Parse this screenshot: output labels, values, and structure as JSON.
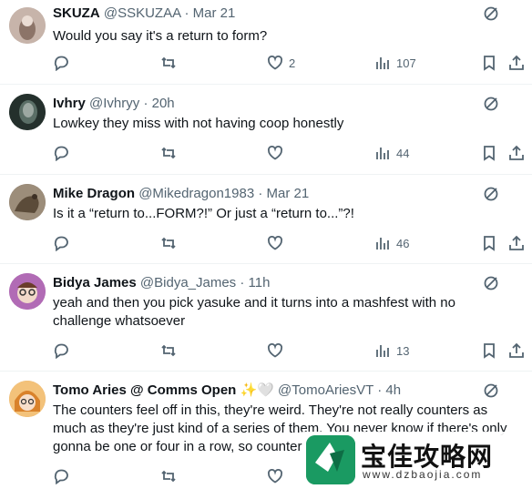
{
  "tweets": [
    {
      "name": "SKUZA",
      "handle": "@SSKUZAA",
      "dot": "·",
      "time": "Mar 21",
      "text": "Would you say it's a return to form?",
      "replies": "",
      "retweets": "",
      "likes": "2",
      "views": "107",
      "avatar_color": "#b9a59a"
    },
    {
      "name": "Ivhry",
      "handle": "@Ivhryy",
      "dot": "·",
      "time": "20h",
      "text": "Lowkey they miss with not having coop honestly",
      "replies": "",
      "retweets": "",
      "likes": "",
      "views": "44",
      "avatar_color": "#2f3b37"
    },
    {
      "name": "Mike Dragon",
      "handle": "@Mikedragon1983",
      "dot": "·",
      "time": "Mar 21",
      "text": "Is it a “return to...FORM?!” Or just a “return to...”?!",
      "replies": "",
      "retweets": "",
      "likes": "",
      "views": "46",
      "avatar_color": "#7b6a55"
    },
    {
      "name": "Bidya James",
      "handle": "@Bidya_James",
      "dot": "·",
      "time": "11h",
      "text": "yeah and then you pick yasuke and it turns into a mashfest with no challenge whatsoever",
      "replies": "",
      "retweets": "",
      "likes": "",
      "views": "13",
      "avatar_color": "#a35aa7"
    },
    {
      "name": "Tomo Aries @ Comms Open",
      "emoji": "✨🤍",
      "handle": "@TomoAriesVT",
      "dot": "·",
      "time": "4h",
      "text": "The counters feel off in this, they're weird. They're not really counters as much as they're just kind of a series of them. You never know if there's only gonna be one or four in a row, so counter",
      "replies": "",
      "retweets": "",
      "likes": "",
      "views": "",
      "avatar_color": "#e3a24c"
    }
  ],
  "watermark": {
    "title": "宝佳攻略网",
    "url": "www.dzbaojia.com"
  },
  "colors": {
    "text": "#0f1419",
    "secondary": "#536471",
    "divider": "#eff3f4"
  }
}
